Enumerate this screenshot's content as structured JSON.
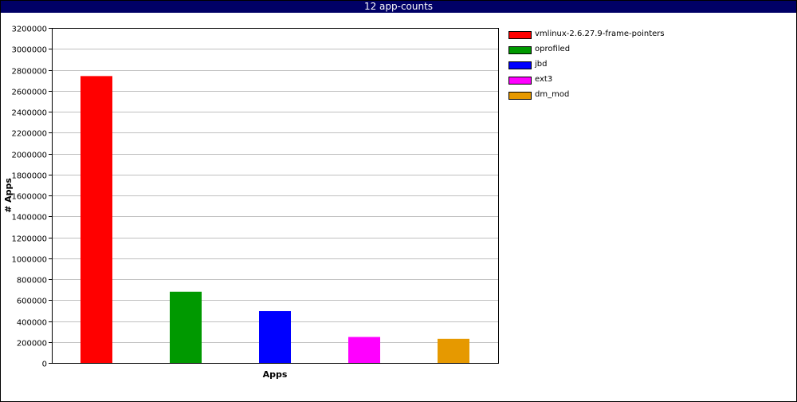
{
  "title": "12 app-counts",
  "chart_data": {
    "type": "bar",
    "title": "12 app-counts",
    "xlabel": "Apps",
    "ylabel": "# Apps",
    "ylim": [
      0,
      3200000
    ],
    "yticks": [
      "0",
      "200000",
      "400000",
      "600000",
      "800000",
      "1000000",
      "1200000",
      "1400000",
      "1600000",
      "1800000",
      "2000000",
      "2200000",
      "2400000",
      "2600000",
      "2800000",
      "3000000",
      "3200000"
    ],
    "grid": true,
    "legend_position": "right",
    "series": [
      {
        "name": "vmlinux-2.6.27.9-frame-pointers",
        "value": 2740000,
        "color": "#ff0000"
      },
      {
        "name": "oprofiled",
        "value": 680000,
        "color": "#009900"
      },
      {
        "name": "jbd",
        "value": 495000,
        "color": "#0000ff"
      },
      {
        "name": "ext3",
        "value": 248000,
        "color": "#ff00ff"
      },
      {
        "name": "dm_mod",
        "value": 230000,
        "color": "#e69900"
      }
    ]
  }
}
